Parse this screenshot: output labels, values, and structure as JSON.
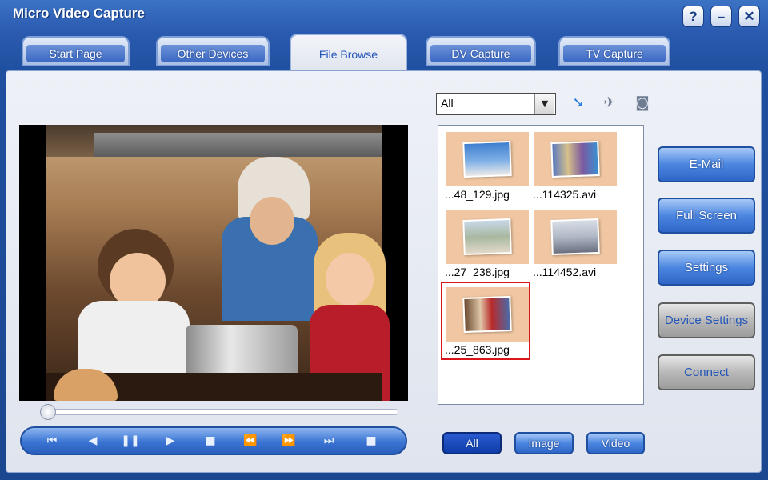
{
  "window": {
    "title": "Micro Video Capture"
  },
  "title_buttons": {
    "help": "?",
    "minimize": "–",
    "close": "✕"
  },
  "tabs": [
    {
      "label": "Start Page",
      "active": false
    },
    {
      "label": "Other Devices",
      "active": false
    },
    {
      "label": "File Browse",
      "active": true
    },
    {
      "label": "DV Capture",
      "active": false
    },
    {
      "label": "TV Capture",
      "active": false
    }
  ],
  "filter": {
    "selected": "All"
  },
  "toolbar_icons": [
    "send-arrow-icon",
    "edit-plane-icon",
    "capture-camera-icon"
  ],
  "player": {
    "progress": 0.0
  },
  "controls": [
    "previous-track-icon",
    "rewind-icon",
    "pause-icon",
    "play-icon",
    "stop-icon",
    "fast-rewind-icon",
    "fast-forward-icon",
    "next-frame-icon",
    "record-icon"
  ],
  "files": [
    {
      "name": "...48_129.jpg",
      "selected": false
    },
    {
      "name": "...114325.avi",
      "selected": false
    },
    {
      "name": "...27_238.jpg",
      "selected": false
    },
    {
      "name": "...114452.avi",
      "selected": false
    },
    {
      "name": "...25_863.jpg",
      "selected": true
    }
  ],
  "side_buttons": {
    "email": "E-Mail",
    "full_screen": "Full Screen",
    "settings": "Settings",
    "device_settings": "Device Settings",
    "connect": "Connect"
  },
  "filter_buttons": {
    "all": "All",
    "image": "Image",
    "video": "Video"
  },
  "colors": {
    "accent": "#2f66c7",
    "selection": "#d8161b",
    "thumb_bg": "#f0c7a2"
  }
}
